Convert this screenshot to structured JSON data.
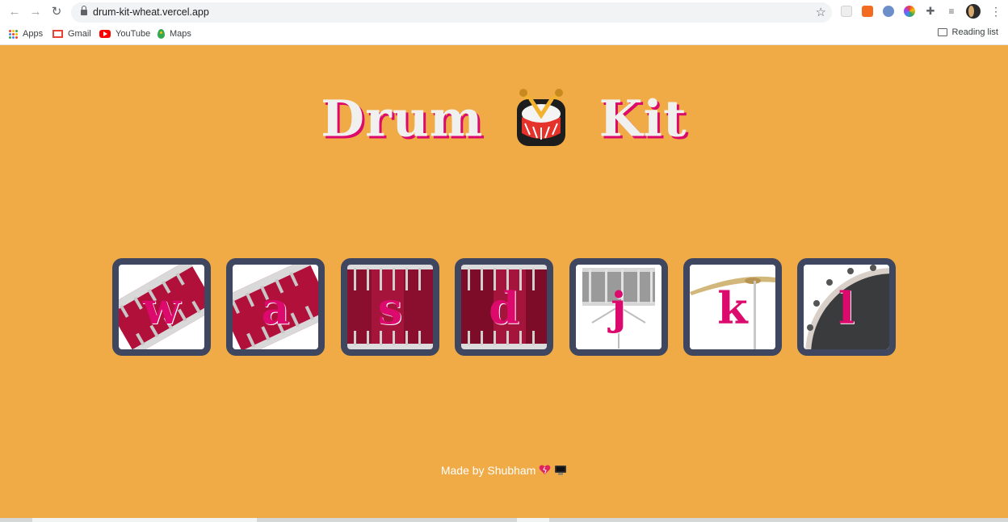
{
  "browser": {
    "url": "drum-kit-wheat.vercel.app",
    "nav_icons": [
      "back-arrow-icon",
      "forward-arrow-icon",
      "reload-icon"
    ],
    "bookmarks": [
      {
        "label": "Apps",
        "icon": "apps-grid-icon"
      },
      {
        "label": "Gmail",
        "icon": "gmail-icon"
      },
      {
        "label": "YouTube",
        "icon": "youtube-icon"
      },
      {
        "label": "Maps",
        "icon": "maps-icon"
      }
    ],
    "reading_list": "Reading list"
  },
  "page": {
    "title_left": "Drum",
    "title_right": "Kit",
    "background": "#f0ab46",
    "accent": "#db0a6c",
    "key_frame": "#3f4760",
    "keys": [
      {
        "letter": "w",
        "drum": "tom-1"
      },
      {
        "letter": "a",
        "drum": "tom-2"
      },
      {
        "letter": "s",
        "drum": "tom-3"
      },
      {
        "letter": "d",
        "drum": "tom-4"
      },
      {
        "letter": "j",
        "drum": "snare"
      },
      {
        "letter": "k",
        "drum": "crash"
      },
      {
        "letter": "l",
        "drum": "kick-bass"
      }
    ],
    "footer": "Made by Shubham"
  }
}
